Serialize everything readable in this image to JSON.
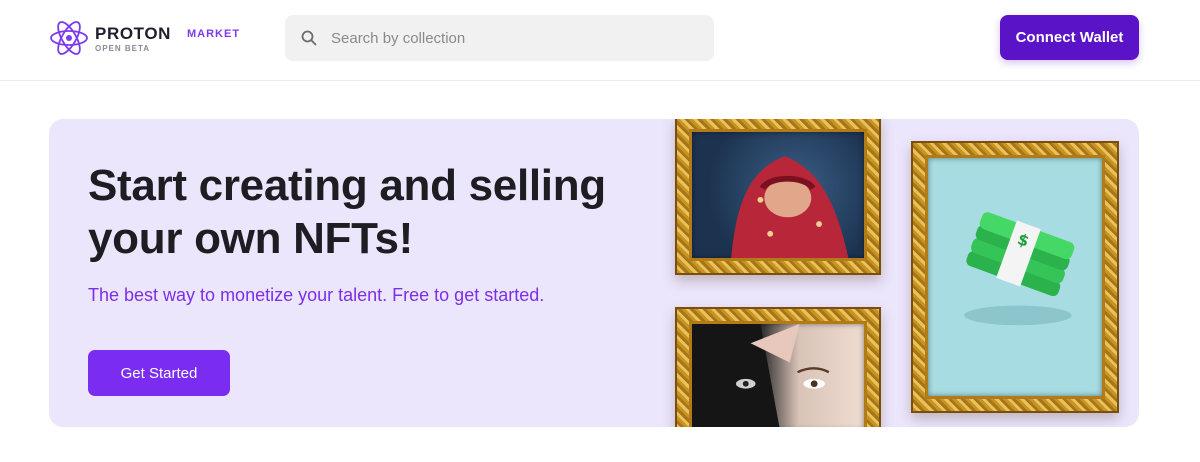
{
  "header": {
    "logo": {
      "name": "PROTON",
      "suffix": "MARKET",
      "badge": "OPEN BETA"
    },
    "search": {
      "placeholder": "Search by collection",
      "value": ""
    },
    "connect_label": "Connect Wallet"
  },
  "hero": {
    "title": "Start creating and selling your own NFTs!",
    "subtitle": "The best way to monetize your talent. Free to get started.",
    "cta_label": "Get Started",
    "artworks": [
      {
        "name": "hooded-character-artwork"
      },
      {
        "name": "cash-stack-artwork"
      },
      {
        "name": "portrait-face-artwork"
      }
    ]
  },
  "colors": {
    "brand": "#5b13c8",
    "accent": "#7a2cf0",
    "hero_bg": "#ece6fd",
    "subtitle": "#7b2fe6",
    "frame_gold": "#c89420"
  },
  "icons": {
    "logo": "atom-orbit-icon",
    "search": "search-icon"
  }
}
